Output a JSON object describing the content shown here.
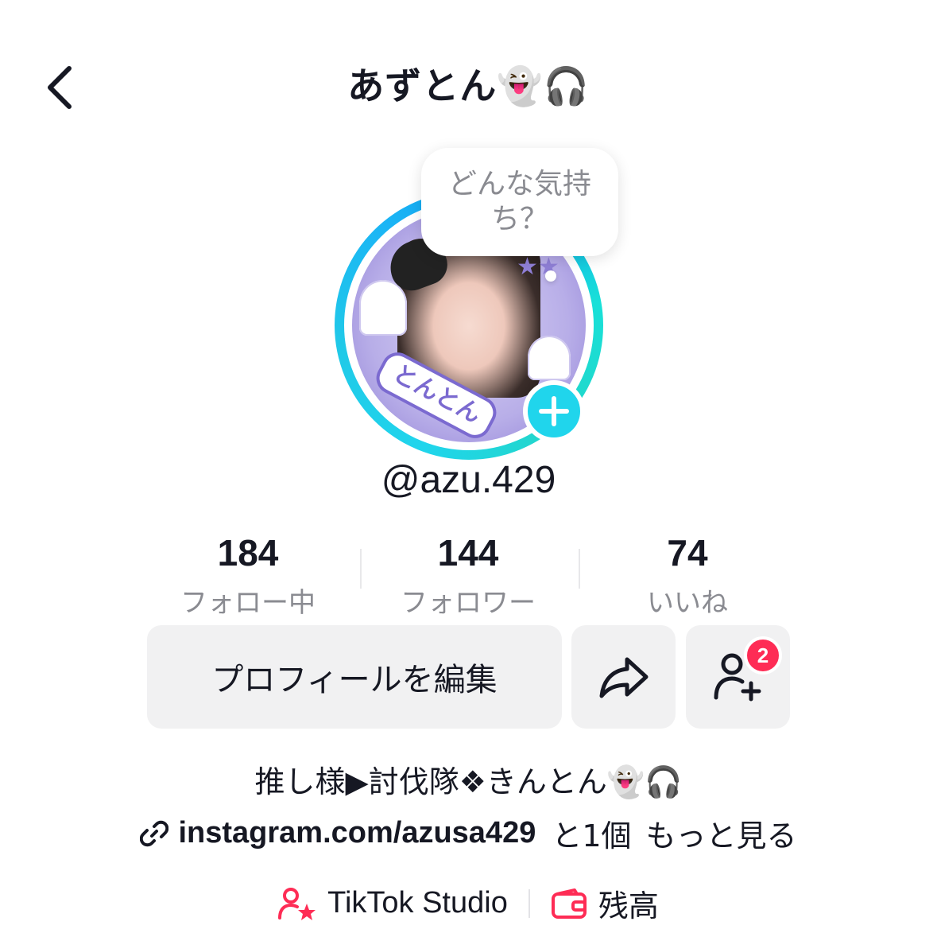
{
  "header": {
    "title": "あずとん👻🎧",
    "back_icon": "chevron-left-icon"
  },
  "profile": {
    "mood_bubble": "どんな気持ち？",
    "avatar_label": "とんとん",
    "username": "@azu.429"
  },
  "stats": [
    {
      "value": "184",
      "label": "フォロー中"
    },
    {
      "value": "144",
      "label": "フォロワー"
    },
    {
      "value": "74",
      "label": "いいね"
    }
  ],
  "actions": {
    "edit_label": "プロフィールを編集",
    "share_icon": "share-arrow-icon",
    "add_friend_icon": "add-person-icon",
    "friend_badge": "2"
  },
  "bio": {
    "text": "推し様▶討伐隊❖きんとん👻🎧",
    "link_icon": "link-icon",
    "link": "instagram.com/azusa429",
    "link_extra": "と1個",
    "more": "もっと見る"
  },
  "bottom": {
    "studio_label": "TikTok Studio",
    "balance_label": "残高"
  },
  "colors": {
    "accent_cyan": "#20d5ec",
    "accent_red": "#fe2c55",
    "text_primary": "#161823",
    "text_secondary": "#8a8b91",
    "button_grey": "#f1f1f2"
  }
}
